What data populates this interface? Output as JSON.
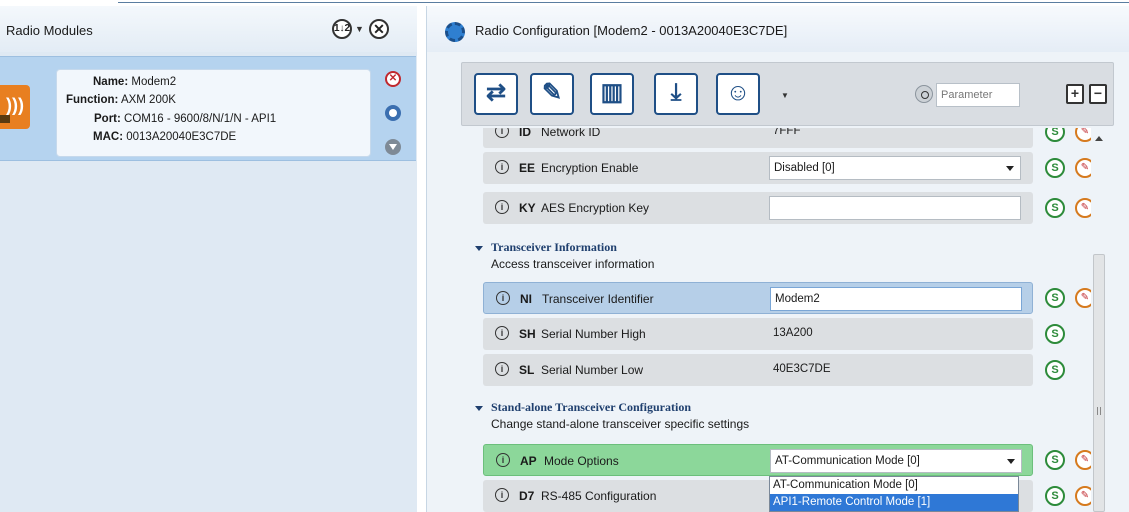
{
  "left_panel": {
    "title": "Radio Modules",
    "sort_icon": "sort-icon",
    "sort_glyph": "1↓2",
    "close_glyph": "✕",
    "module": {
      "name_label": "Name:",
      "name": "Modem2",
      "function_label": "Function:",
      "function": "AXM 200K",
      "port_label": "Port:",
      "port": "COM16 - 9600/8/N/1/N - API1",
      "mac_label": "MAC:",
      "mac": "0013A20040E3C7DE",
      "close_glyph": "✕"
    }
  },
  "right_panel": {
    "title": "Radio Configuration [Modem2 - 0013A20040E3C7DE]",
    "toolbar": {
      "buttons": [
        {
          "icon": "read-icon",
          "glyph": "⇄"
        },
        {
          "icon": "write-icon",
          "glyph": "✎"
        },
        {
          "icon": "defaults-icon",
          "glyph": "▥"
        },
        {
          "icon": "update-firmware-icon",
          "glyph": "⤓"
        },
        {
          "icon": "profile-icon",
          "glyph": "☺"
        }
      ],
      "search_placeholder": "Parameter",
      "expand_glyph": "+",
      "collapse_glyph": "−"
    },
    "parameters": {
      "id": {
        "code": "ID",
        "name": "Network ID",
        "value": "7FFF"
      },
      "ee": {
        "code": "EE",
        "name": "Encryption Enable",
        "value": "Disabled [0]"
      },
      "ky": {
        "code": "KY",
        "name": "AES Encryption Key",
        "value": ""
      },
      "ni": {
        "code": "NI",
        "name": "Transceiver Identifier",
        "value": "Modem2"
      },
      "sh": {
        "code": "SH",
        "name": "Serial Number High",
        "value": "13A200"
      },
      "sl": {
        "code": "SL",
        "name": "Serial Number Low",
        "value": "40E3C7DE"
      },
      "ap": {
        "code": "AP",
        "name": "Mode Options",
        "value": "AT-Communication Mode [0]"
      },
      "d7": {
        "code": "D7",
        "name": "RS-485 Configuration",
        "value": ""
      }
    },
    "sections": {
      "transceiver_info": {
        "title": "Transceiver Information",
        "desc": "Access transceiver information"
      },
      "standalone": {
        "title": "Stand-alone Transceiver Configuration",
        "desc": "Change stand-alone transceiver specific settings"
      }
    },
    "dropdown_options": [
      "AT-Communication Mode [0]",
      "API1-Remote Control Mode [1]"
    ],
    "info_glyph": "i",
    "read_glyph": "S",
    "write_glyph": "✎"
  }
}
